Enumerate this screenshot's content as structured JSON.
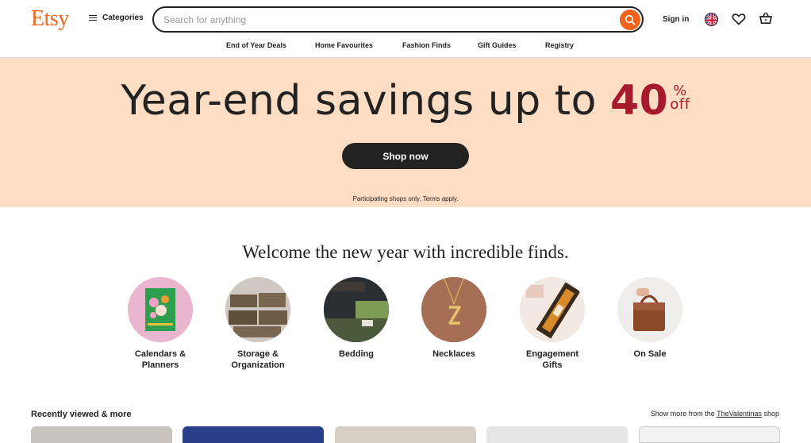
{
  "header": {
    "logo": "Etsy",
    "categories_label": "Categories",
    "search_placeholder": "Search for anything",
    "signin_label": "Sign in"
  },
  "subnav": [
    "End of Year Deals",
    "Home Favourites",
    "Fashion Finds",
    "Gift Guides",
    "Registry"
  ],
  "banner": {
    "title_main": "Year-end savings up to ",
    "title_value": "40",
    "title_pct": "%",
    "title_off": "off",
    "cta": "Shop now",
    "terms": "Participating shops only. Terms apply."
  },
  "welcome": "Welcome the new year with incredible finds.",
  "categories": [
    {
      "line1": "Calendars &",
      "line2": "Planners"
    },
    {
      "line1": "Storage &",
      "line2": "Organization"
    },
    {
      "line1": "Bedding",
      "line2": ""
    },
    {
      "line1": "Necklaces",
      "line2": ""
    },
    {
      "line1": "Engagement",
      "line2": "Gifts"
    },
    {
      "line1": "On Sale",
      "line2": ""
    }
  ],
  "recent": {
    "title": "Recently viewed & more",
    "more_prefix": "Show more from the ",
    "shop_name": "TheValentinas",
    "more_suffix": " shop"
  },
  "colors": {
    "brand": "#F1641E",
    "banner_bg": "#FDDDC3",
    "accent": "#A61A2E"
  }
}
